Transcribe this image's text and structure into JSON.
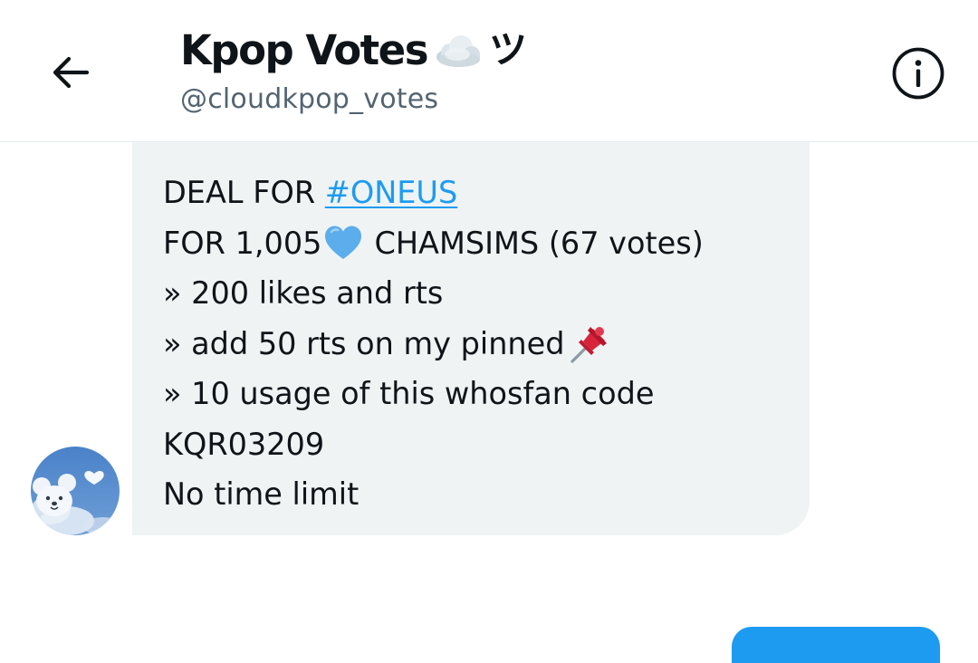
{
  "header": {
    "title": "Kpop Votes",
    "title_suffix": "ツ",
    "handle": "@cloudkpop_votes",
    "back_icon": "arrow-left-icon",
    "info_icon": "info-circle-icon",
    "title_emoji": "cloud-emoji"
  },
  "message": {
    "line1_prefix": "DEAL FOR ",
    "line1_hashtag": "#ONEUS",
    "line2_prefix": "FOR 1,005",
    "line2_suffix": "CHAMSIMS (67 votes)",
    "line3": "» 200 likes and rts",
    "line4": "» add 50 rts on my pinned",
    "line5": "» 10 usage of this whosfan code",
    "line6": "KQR03209",
    "line7": "No time limit",
    "heart_emoji": "blue-heart-emoji",
    "pin_emoji": "pushpin-emoji"
  },
  "colors": {
    "accent": "#1d9bf0",
    "bubble": "#eff3f4",
    "text": "#0f1419",
    "secondary_text": "#536471",
    "divider": "#e6e9ec"
  }
}
